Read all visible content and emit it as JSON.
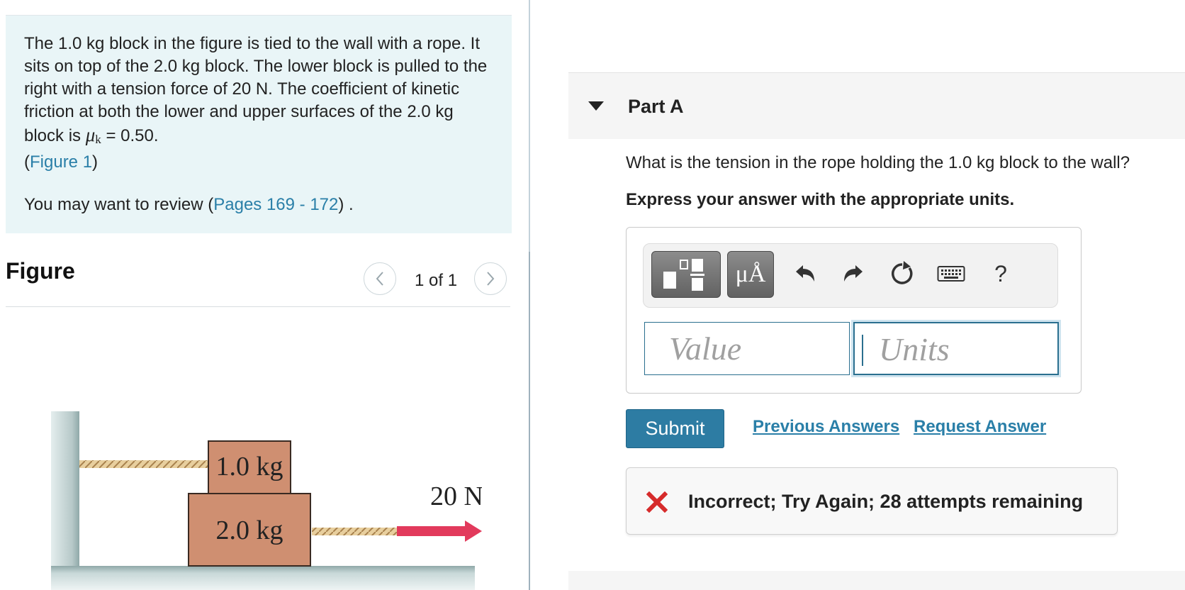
{
  "problem": {
    "text": "The 1.0 kg block in the figure is tied to the wall with a rope. It sits on top of the 2.0 kg block. The lower block is pulled to the right with a tension force of 20 N. The coefficient of kinetic friction at both the lower and upper surfaces of the 2.0 kg block is",
    "mu_symbol": "μ",
    "mu_subscript": "k",
    "mu_value": "= 0.50.",
    "figure_link": "Figure 1",
    "review_prefix": "You may want to review (",
    "review_link": "Pages 169 - 172",
    "review_suffix": ") ."
  },
  "figure": {
    "title": "Figure",
    "page_indicator": "1 of 1",
    "upper_block_label": "1.0 kg",
    "lower_block_label": "2.0 kg",
    "force_label": "20 N"
  },
  "part": {
    "title": "Part A",
    "question": "What is the tension in the rope holding the 1.0 kg block to the wall?",
    "instruction": "Express your answer with the appropriate units."
  },
  "toolbar": {
    "units_label": "μÅ",
    "help_label": "?"
  },
  "inputs": {
    "value_placeholder": "Value",
    "units_placeholder": "Units"
  },
  "actions": {
    "submit": "Submit",
    "previous_answers": "Previous Answers",
    "request_answer": "Request Answer"
  },
  "feedback": {
    "message": "Incorrect; Try Again; 28 attempts remaining"
  },
  "colors": {
    "link": "#2a7fa8",
    "submit": "#2d7ca3",
    "error": "#d62b2b",
    "problem_bg": "#e9f5f7",
    "arrow": "#e23a5c",
    "block": "#cf8f71"
  }
}
